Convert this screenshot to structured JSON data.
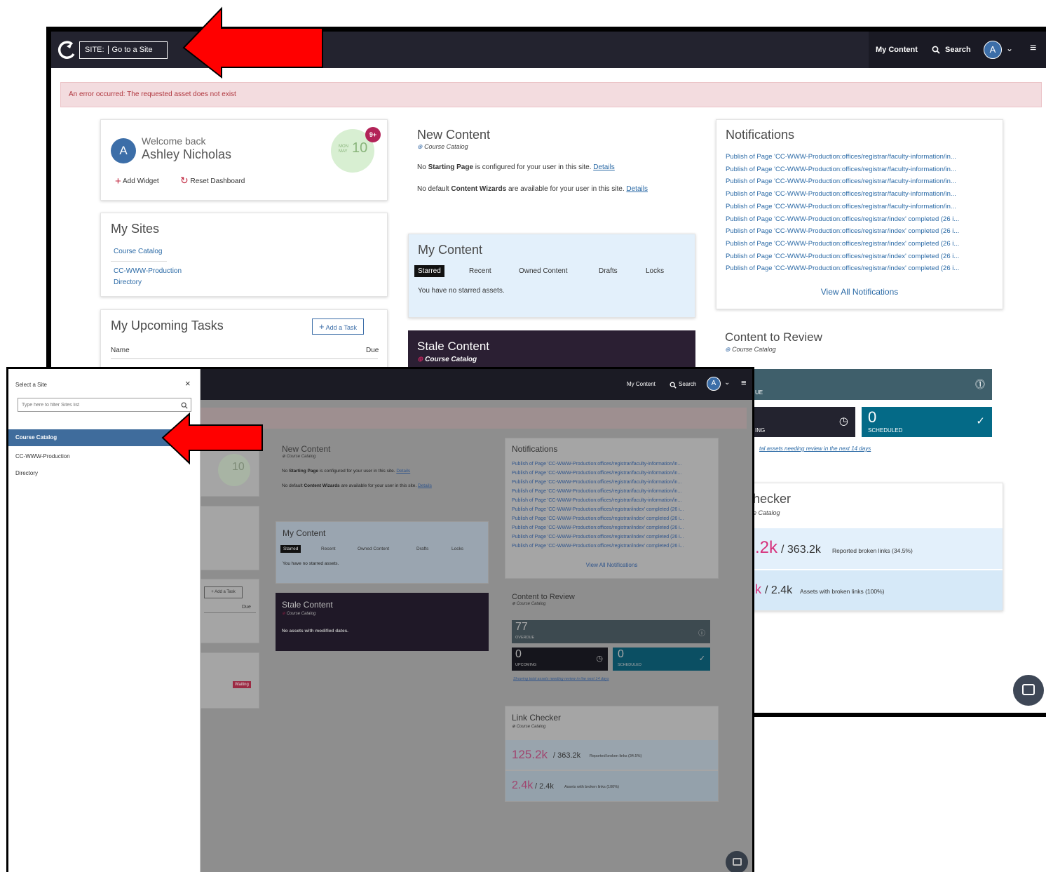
{
  "back": {
    "site_prefix": "SITE:",
    "site_value": "Go to a Site",
    "nav": {
      "my_content": "My Content",
      "search": "Search",
      "avatar_letter": "A"
    },
    "error": "An error occurred: The requested asset does not exist",
    "welcome": {
      "greeting": "Welcome back",
      "name": "Ashley Nicholas",
      "avatar_letter": "A",
      "day": "MON",
      "month": "MAY",
      "date": "10",
      "badge": "9+",
      "add_widget": "Add Widget",
      "reset_dashboard": "Reset Dashboard"
    },
    "my_sites": {
      "title": "My Sites",
      "items": [
        "Course Catalog",
        "CC-WWW-Production",
        "Directory"
      ]
    },
    "tasks": {
      "title": "My Upcoming Tasks",
      "add": "Add a Task",
      "col_name": "Name",
      "col_due": "Due"
    },
    "new_content": {
      "title": "New Content",
      "site": "Course Catalog",
      "line1_pre": "No ",
      "line1_bold": "Starting Page",
      "line1_post": " is configured for your user in this site. ",
      "line2_pre": "No default ",
      "line2_bold": "Content Wizards",
      "line2_post": " are available for your user in this site. ",
      "details": "Details"
    },
    "my_content": {
      "title": "My Content",
      "tabs": [
        "Starred",
        "Recent",
        "Owned Content",
        "Drafts",
        "Locks"
      ],
      "empty": "You have no starred assets."
    },
    "stale": {
      "title": "Stale Content",
      "site": "Course Catalog"
    },
    "notifications": {
      "title": "Notifications",
      "items": [
        "Publish of Page 'CC-WWW-Production:offices/registrar/faculty-information/in...",
        "Publish of Page 'CC-WWW-Production:offices/registrar/faculty-information/in...",
        "Publish of Page 'CC-WWW-Production:offices/registrar/faculty-information/in...",
        "Publish of Page 'CC-WWW-Production:offices/registrar/faculty-information/in...",
        "Publish of Page 'CC-WWW-Production:offices/registrar/faculty-information/in...",
        "Publish of Page 'CC-WWW-Production:offices/registrar/index' completed (26 i...",
        "Publish of Page 'CC-WWW-Production:offices/registrar/index' completed (26 i...",
        "Publish of Page 'CC-WWW-Production:offices/registrar/index' completed (26 i...",
        "Publish of Page 'CC-WWW-Production:offices/registrar/index' completed (26 i...",
        "Publish of Page 'CC-WWW-Production:offices/registrar/index' completed (26 i..."
      ],
      "view_all": "View All Notifications"
    },
    "review": {
      "title": "Content to Review",
      "site": "Course Catalog",
      "overdue_label": "UE",
      "upcoming_label": "ING",
      "scheduled_value": "0",
      "scheduled_label": "SCHEDULED",
      "footer": "tal assets needing review in the next 14 days"
    },
    "link_checker": {
      "title": "hecker",
      "site": "e Catalog",
      "row1_value": ".2k",
      "row1_total": " / 363.2k",
      "row1_label": "Reported broken links (34.5%)",
      "row2_value": "k",
      "row2_total": " / 2.4k",
      "row2_label": "Assets with broken links (100%)"
    }
  },
  "front": {
    "panel": {
      "title": "Select a Site",
      "filter_placeholder": "Type here to filter Sites list",
      "items": [
        "Course Catalog",
        "CC-WWW-Production",
        "Directory"
      ]
    },
    "nav": {
      "my_content": "My Content",
      "search": "Search",
      "avatar_letter": "A"
    },
    "welcome_date": "10",
    "new_content": {
      "title": "New Content",
      "site": "Course Catalog",
      "line1_pre": "No ",
      "line1_bold": "Starting Page",
      "line1_post": " is configured for your user in this site. ",
      "line2_pre": "No default ",
      "line2_bold": "Content Wizards",
      "line2_post": " are available for your user in this site. ",
      "details": "Details"
    },
    "my_content": {
      "title": "My Content",
      "tabs": [
        "Starred",
        "Recent",
        "Owned Content",
        "Drafts",
        "Locks"
      ],
      "empty": "You have no starred assets."
    },
    "tasks": {
      "add": "Add a Task",
      "col_due": "Due",
      "status": "Waiting"
    },
    "stale": {
      "title": "Stale Content",
      "site": "Course Catalog",
      "empty": "No assets with modified dates."
    },
    "notifications": {
      "title": "Notifications",
      "items": [
        "Publish of Page 'CC-WWW-Production:offices/registrar/faculty-information/in...",
        "Publish of Page 'CC-WWW-Production:offices/registrar/faculty-information/in...",
        "Publish of Page 'CC-WWW-Production:offices/registrar/faculty-information/in...",
        "Publish of Page 'CC-WWW-Production:offices/registrar/faculty-information/in...",
        "Publish of Page 'CC-WWW-Production:offices/registrar/faculty-information/in...",
        "Publish of Page 'CC-WWW-Production:offices/registrar/index' completed (26 i...",
        "Publish of Page 'CC-WWW-Production:offices/registrar/index' completed (26 i...",
        "Publish of Page 'CC-WWW-Production:offices/registrar/index' completed (26 i...",
        "Publish of Page 'CC-WWW-Production:offices/registrar/index' completed (26 i...",
        "Publish of Page 'CC-WWW-Production:offices/registrar/index' completed (26 i..."
      ],
      "view_all": "View All Notifications"
    },
    "review": {
      "title": "Content to Review",
      "site": "Course Catalog",
      "overdue_value": "77",
      "overdue_label": "OVERDUE",
      "upcoming_value": "0",
      "upcoming_label": "UPCOMING",
      "scheduled_value": "0",
      "scheduled_label": "SCHEDULED",
      "footer": "Showing total assets needing review in the next 14 days"
    },
    "link_checker": {
      "title": "Link Checker",
      "site": "Course Catalog",
      "row1_value": "125.2k",
      "row1_total": " / 363.2k",
      "row1_label": "Reported broken links (34.5%)",
      "row2_value": "2.4k",
      "row2_total": " / 2.4k",
      "row2_label": "Assets with broken links (100%)"
    }
  },
  "colors": {
    "nav": "#23232f",
    "accent_blue": "#3c6ea8",
    "error_bg": "#f3dcdf",
    "arrow": "#ff0000",
    "pink": "#d6307b",
    "teal": "#046a87"
  }
}
